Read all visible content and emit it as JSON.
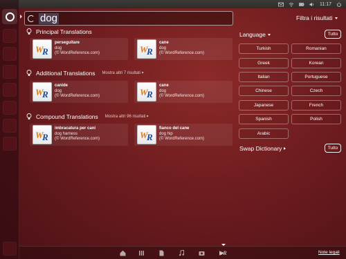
{
  "top_panel": {
    "time": "11:17"
  },
  "search": {
    "query": "dog"
  },
  "filter_toggle": {
    "label": "Filtra i risultati"
  },
  "categories": [
    {
      "title": "Principal Translations",
      "more": "",
      "results": [
        {
          "title": "perseguitare",
          "line1": "dog",
          "line2": "(© WordReference.com)"
        },
        {
          "title": "cane",
          "line1": "dog",
          "line2": "(© WordReference.com)"
        }
      ]
    },
    {
      "title": "Additional Translations",
      "more": "Mostra altri 7 risultati",
      "results": [
        {
          "title": "canide",
          "line1": "dog",
          "line2": "(© WordReference.com)"
        },
        {
          "title": "cane",
          "line1": "dog",
          "line2": "(© WordReference.com)"
        }
      ]
    },
    {
      "title": "Compound Translations",
      "more": "Mostra altri 96 risultati",
      "results": [
        {
          "title": "imbracatura per cani",
          "line1": "dog harness",
          "line2": "(© WordReference.com)"
        },
        {
          "title": "fianco del cane",
          "line1": "dog hip",
          "line2": "(© WordReference.com)"
        }
      ]
    }
  ],
  "filters": {
    "language": {
      "label": "Language",
      "all_label": "Tutto",
      "options": [
        "Turkish",
        "Romanian",
        "Greek",
        "Korean",
        "Italian",
        "Portuguese",
        "Chinese",
        "Czech",
        "Japanese",
        "French",
        "Spanish",
        "Polish",
        "Arabic"
      ]
    },
    "swap": {
      "label": "Swap Dictionary",
      "all_label": "Tutto"
    }
  },
  "legal": "Note legali",
  "colors": {
    "accent": "#e07a13",
    "brand_blue": "#1a4c98",
    "background": "#6e1c1f"
  }
}
